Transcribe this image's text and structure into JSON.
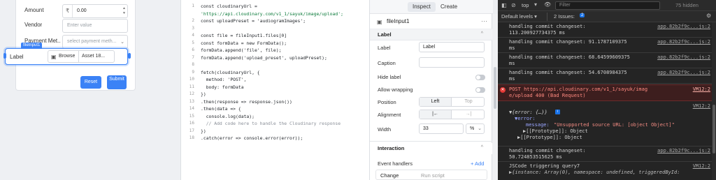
{
  "form": {
    "amount_label": "Amount",
    "amount_currency": "₹",
    "amount_value": "0.00",
    "vendor_label": "Vendor",
    "vendor_placeholder": "Enter value",
    "payment_label": "Payment Met...",
    "payment_placeholder": "select payment meth...",
    "file_label": "Label",
    "file_tag": "fileInput1",
    "browse_label": "Browse",
    "asset_label": "Asset 18...",
    "reset_label": "Reset",
    "submit_label": "Submit"
  },
  "editor": {
    "lines": [
      {
        "n": "1",
        "text": "const cloudinaryUrl =",
        "cls": ""
      },
      {
        "n": "",
        "text": "'https://api.cloudinary.com/v1_1/sayuk/image/upload';",
        "cls": "str"
      },
      {
        "n": "2",
        "text": "const uploadPreset = 'audiogramImages';",
        "cls": ""
      },
      {
        "n": "3",
        "text": "",
        "cls": ""
      },
      {
        "n": "4",
        "text": "const file = fileInput1.files[0]",
        "cls": ""
      },
      {
        "n": "5",
        "text": "const formData = new FormData();",
        "cls": ""
      },
      {
        "n": "6",
        "text": "formData.append('file', file);",
        "cls": ""
      },
      {
        "n": "7",
        "text": "formData.append('upload_preset', uploadPreset);",
        "cls": ""
      },
      {
        "n": "8",
        "text": "",
        "cls": ""
      },
      {
        "n": "9",
        "text": "fetch(cloudinaryUrl, {",
        "cls": ""
      },
      {
        "n": "10",
        "text": "  method: 'POST',",
        "cls": ""
      },
      {
        "n": "11",
        "text": "  body: formData",
        "cls": ""
      },
      {
        "n": "12",
        "text": "})",
        "cls": ""
      },
      {
        "n": "13",
        "text": ".then(response => response.json())",
        "cls": ""
      },
      {
        "n": "14",
        "text": ".then(data => {",
        "cls": ""
      },
      {
        "n": "15",
        "text": "  console.log(data);",
        "cls": ""
      },
      {
        "n": "16",
        "text": "  // Add code here to handle the Cloudinary response",
        "cls": "cm"
      },
      {
        "n": "17",
        "text": "})",
        "cls": ""
      },
      {
        "n": "18",
        "text": ".catch(error => console.error(error));",
        "cls": ""
      }
    ]
  },
  "inspector": {
    "tab_inspect": "Inspect",
    "tab_create": "Create",
    "component_name": "fileInput1",
    "more": "···",
    "section_label": "Label",
    "label_prop": "Label",
    "label_value": "Label",
    "caption_prop": "Caption",
    "hide_label_prop": "Hide label",
    "allow_wrapping_prop": "Allow wrapping",
    "position_prop": "Position",
    "position_left": "Left",
    "position_top": "Top",
    "alignment_prop": "Alignment",
    "align_left": "|←",
    "align_right": "→|",
    "width_prop": "Width",
    "width_value": "33",
    "width_unit": "%",
    "section_interaction": "Interaction",
    "event_handlers_label": "Event handlers",
    "add_label": "+ Add",
    "change_label": "Change",
    "run_script_label": "Run script"
  },
  "devtools": {
    "context": "top",
    "filter_placeholder": "Filter",
    "hidden_count": "75 hidden",
    "levels_label": "Default levels ▾",
    "issues_label": "2 Issues:",
    "issues_count": "2",
    "messages": [
      {
        "text": "handling commit changeset:\n113.200927734375 ms",
        "src": "app.82b2f9c...js:2"
      },
      {
        "text": "handling commit changeset: 91.1787109375\nms",
        "src": "app.82b2f9c...js:2"
      },
      {
        "text": "handling commit changeset: 68.64599609375\nms",
        "src": "app.82b2f9c...js:2"
      },
      {
        "text": "handling commit changeset: 54.6708984375\nms",
        "src": "app.82b2f9c...js:2"
      }
    ],
    "error_text": "POST https://api.cloudinary.com/v1_1/sayuk/imag\ne/upload 400 (Bad Request)",
    "error_src": "VM12:2",
    "obj_src": "VM12:2",
    "obj_line1": "▼{error: {…}}",
    "obj_line2": "▼error:",
    "obj_message_key": "message:",
    "obj_message_val": "\"Unsupported source URL: [object Object]\"",
    "obj_proto1": "▶[[Prototype]]: Object",
    "obj_proto2": "▶[[Prototype]]: Object",
    "tail_msg1": "handling commit changeset:\n50.724853515625 ms",
    "tail_src1": "app.82b2f9c...js:2",
    "tail_msg2": "JSCode triggering query7",
    "tail_src2": "VM12:2",
    "tail_msg3": "▶{instance: Array(0), namespace: undefined, triggeredById:",
    "tail_src3": ""
  }
}
